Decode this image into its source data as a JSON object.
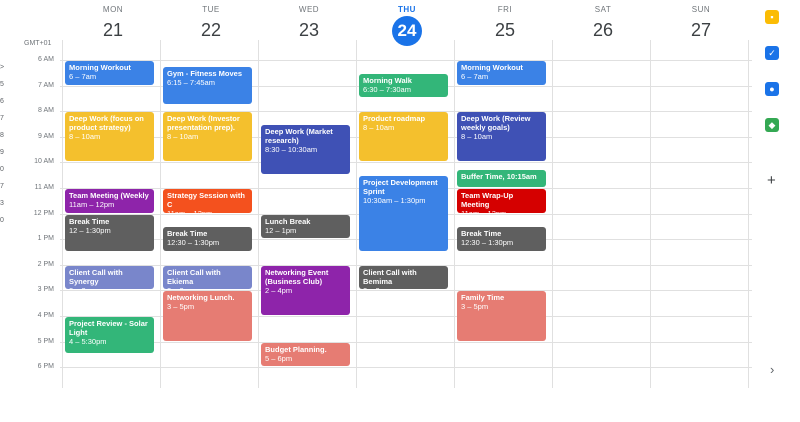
{
  "timezone": "GMT+01",
  "days": [
    {
      "dow": "MON",
      "date": "21",
      "today": false
    },
    {
      "dow": "TUE",
      "date": "22",
      "today": false
    },
    {
      "dow": "WED",
      "date": "23",
      "today": false
    },
    {
      "dow": "THU",
      "date": "24",
      "today": true
    },
    {
      "dow": "FRI",
      "date": "25",
      "today": false
    },
    {
      "dow": "SAT",
      "date": "26",
      "today": false
    },
    {
      "dow": "SUN",
      "date": "27",
      "today": false
    }
  ],
  "hours": [
    "6 AM",
    "7 AM",
    "8 AM",
    "9 AM",
    "10 AM",
    "11 AM",
    "12 PM",
    "1 PM",
    "2 PM",
    "3 PM",
    "4 PM",
    "5 PM",
    "6 PM"
  ],
  "left_strip": [
    ">",
    "5",
    "6",
    "7",
    "8",
    "9",
    "0",
    "7",
    "3",
    "0"
  ],
  "events": [
    {
      "day": 0,
      "start": 6.0,
      "end": 7.0,
      "title": "Morning Workout",
      "time": "6 – 7am",
      "color": "#3b82e6"
    },
    {
      "day": 0,
      "start": 8.0,
      "end": 10.0,
      "title": "Deep Work (focus on product strategy)",
      "time": "8 – 10am",
      "color": "#f4c02d"
    },
    {
      "day": 0,
      "start": 11.0,
      "end": 12.0,
      "title": "Team Meeting (Weekly",
      "time": "11am – 12pm",
      "color": "#8e24aa"
    },
    {
      "day": 0,
      "start": 12.0,
      "end": 13.5,
      "title": "Break Time",
      "time": "12 – 1:30pm",
      "color": "#5f5f5f"
    },
    {
      "day": 0,
      "start": 14.0,
      "end": 15.0,
      "title": "Client Call with Synergy",
      "time": "2 – 3pm",
      "color": "#7986cb"
    },
    {
      "day": 0,
      "start": 16.0,
      "end": 17.5,
      "title": "Project Review - Solar Light",
      "time": "4 – 5:30pm",
      "color": "#33b679"
    },
    {
      "day": 1,
      "start": 6.25,
      "end": 7.75,
      "title": "Gym - Fitness Moves",
      "time": "6:15 – 7:45am",
      "color": "#3b82e6"
    },
    {
      "day": 1,
      "start": 8.0,
      "end": 10.0,
      "title": "Deep Work (Investor presentation prep).",
      "time": "8 – 10am",
      "color": "#f4c02d"
    },
    {
      "day": 1,
      "start": 11.0,
      "end": 12.0,
      "title": "Strategy Session with C",
      "time": "11am – 12pm",
      "color": "#f4511e"
    },
    {
      "day": 1,
      "start": 12.5,
      "end": 13.5,
      "title": "Break Time",
      "time": "12:30 – 1:30pm",
      "color": "#5f5f5f"
    },
    {
      "day": 1,
      "start": 14.0,
      "end": 15.0,
      "title": "Client Call with Ekiema",
      "time": "2 – 3pm",
      "color": "#7986cb"
    },
    {
      "day": 1,
      "start": 15.0,
      "end": 17.0,
      "title": "Networking Lunch.",
      "time": "3 – 5pm",
      "color": "#e67c73"
    },
    {
      "day": 2,
      "start": 8.5,
      "end": 10.5,
      "title": "Deep Work (Market research)",
      "time": "8:30 – 10:30am",
      "color": "#3f51b5"
    },
    {
      "day": 2,
      "start": 12.0,
      "end": 13.0,
      "title": "Lunch Break",
      "time": "12 – 1pm",
      "color": "#5f5f5f"
    },
    {
      "day": 2,
      "start": 14.0,
      "end": 16.0,
      "title": "Networking Event (Business Club)",
      "time": "2 – 4pm",
      "color": "#8e24aa"
    },
    {
      "day": 2,
      "start": 17.0,
      "end": 18.0,
      "title": "Budget Planning.",
      "time": "5 – 6pm",
      "color": "#e67c73"
    },
    {
      "day": 3,
      "start": 6.5,
      "end": 7.5,
      "title": "Morning Walk",
      "time": "6:30 – 7:30am",
      "color": "#33b679"
    },
    {
      "day": 3,
      "start": 8.0,
      "end": 10.0,
      "title": "Product roadmap",
      "time": "8 – 10am",
      "color": "#f4c02d"
    },
    {
      "day": 3,
      "start": 10.5,
      "end": 13.5,
      "title": "Project Development Sprint",
      "time": "10:30am – 1:30pm",
      "color": "#3b82e6"
    },
    {
      "day": 3,
      "start": 14.0,
      "end": 15.0,
      "title": "Client Call with Bemima",
      "time": "2 – 3pm",
      "color": "#5f5f5f"
    },
    {
      "day": 4,
      "start": 6.0,
      "end": 7.0,
      "title": "Morning Workout",
      "time": "6 – 7am",
      "color": "#3b82e6"
    },
    {
      "day": 4,
      "start": 8.0,
      "end": 10.0,
      "title": "Deep Work (Review weekly goals)",
      "time": "8 – 10am",
      "color": "#3f51b5"
    },
    {
      "day": 4,
      "start": 10.25,
      "end": 11.0,
      "title": "Buffer Time, 10:15am",
      "time": "",
      "color": "#33b679"
    },
    {
      "day": 4,
      "start": 11.0,
      "end": 12.0,
      "title": "Team Wrap-Up Meeting",
      "time": "11am – 12pm",
      "color": "#d50000"
    },
    {
      "day": 4,
      "start": 12.5,
      "end": 13.5,
      "title": "Break Time",
      "time": "12:30 – 1:30pm",
      "color": "#5f5f5f"
    },
    {
      "day": 4,
      "start": 15.0,
      "end": 17.0,
      "title": "Family Time",
      "time": "3 – 5pm",
      "color": "#e67c73"
    }
  ],
  "side_icons": [
    {
      "name": "keep-icon",
      "color": "#fbbc04",
      "glyph": "▪"
    },
    {
      "name": "tasks-icon",
      "color": "#1a73e8",
      "glyph": "✓"
    },
    {
      "name": "contacts-icon",
      "color": "#1a73e8",
      "glyph": "●"
    },
    {
      "name": "maps-icon",
      "color": "#34a853",
      "glyph": "◆"
    }
  ],
  "add_label": "+",
  "collapse_label": "›"
}
